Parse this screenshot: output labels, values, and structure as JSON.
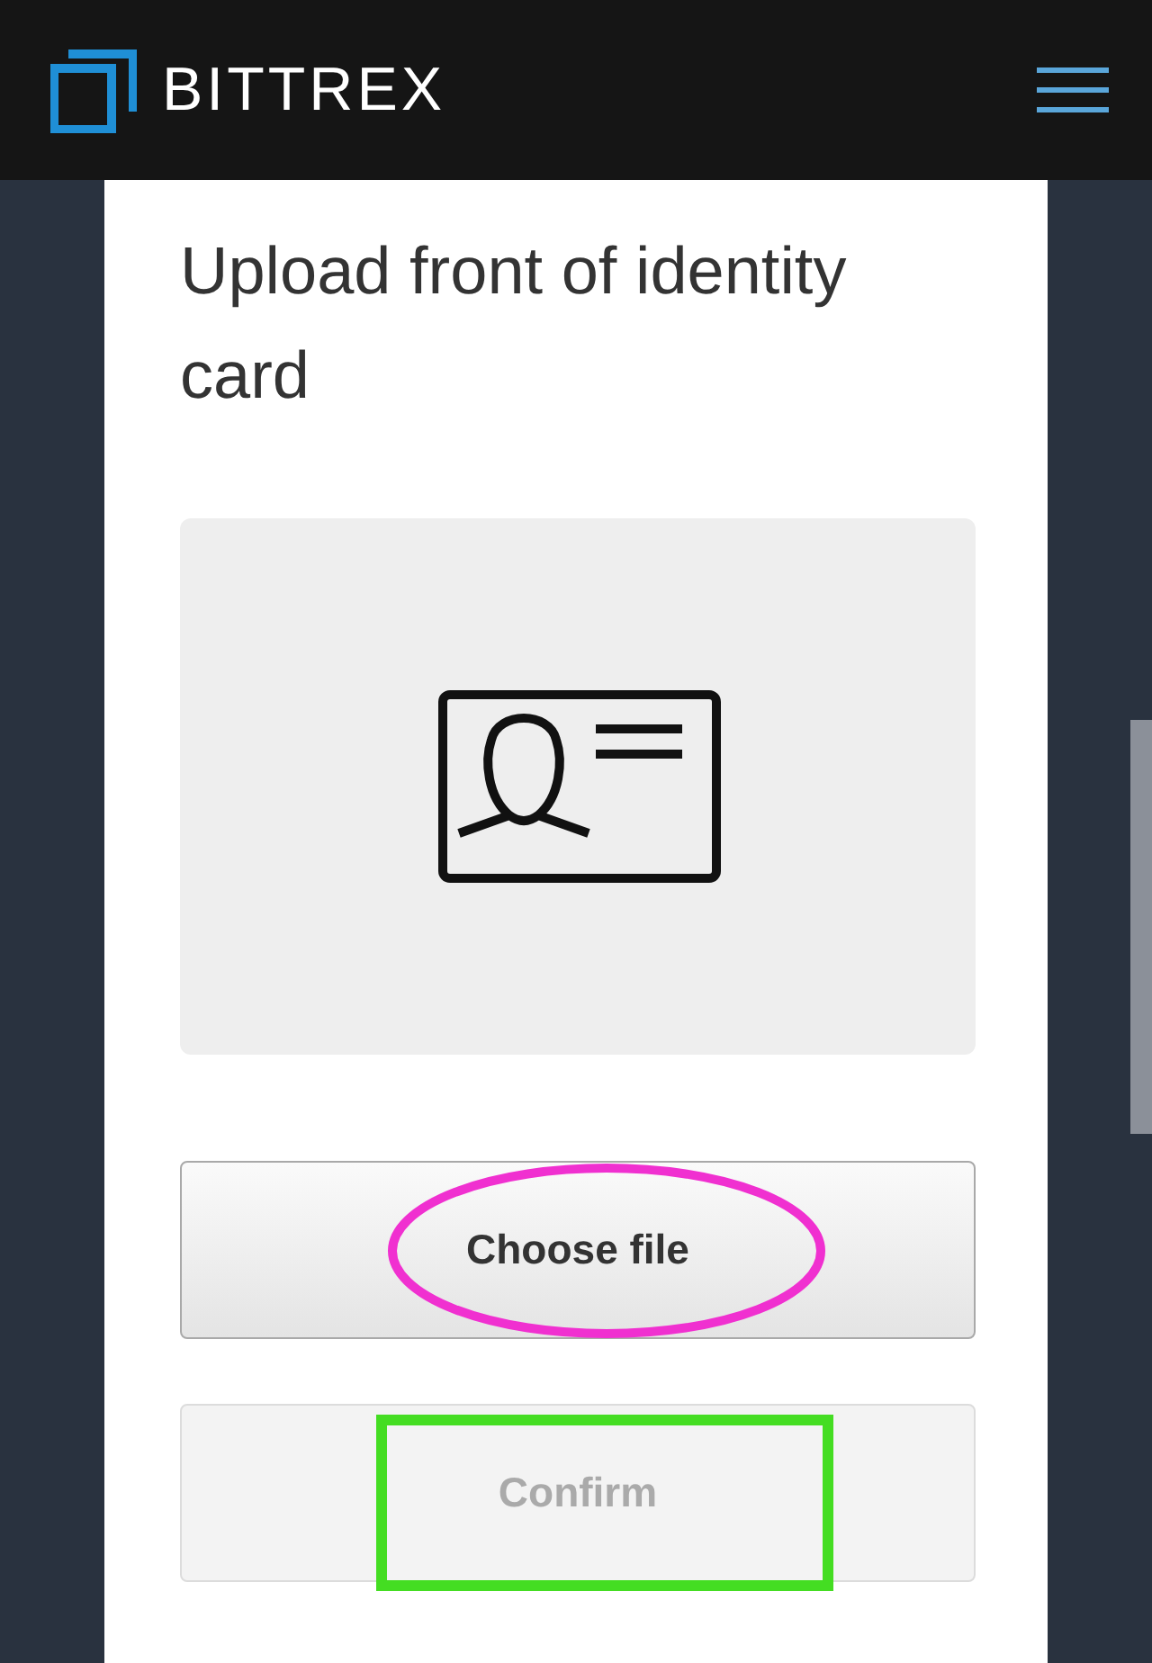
{
  "header": {
    "brand": "BITTREX",
    "menu_open": false
  },
  "title": "Upload front of identity card",
  "buttons": [
    {
      "label": "Choose file",
      "disabled": false,
      "annotation": {
        "kind": "ellipse",
        "color": "#f030d0"
      }
    },
    {
      "label": "Confirm",
      "disabled": true,
      "annotation": {
        "kind": "rectangle",
        "color": "#44dd22"
      }
    }
  ]
}
